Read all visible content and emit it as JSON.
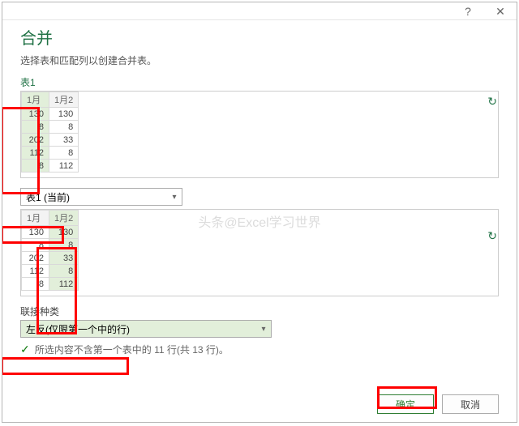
{
  "titlebar": {
    "help_icon": "?",
    "close_icon": "✕"
  },
  "header": {
    "title": "合并",
    "subtitle": "选择表和匹配列以创建合并表。"
  },
  "section1": {
    "label": "表1",
    "refresh_icon": "↻",
    "columns": [
      "1月",
      "1月2"
    ],
    "highlight_col_index": 0,
    "rows": [
      [
        130,
        130
      ],
      [
        8,
        8
      ],
      [
        202,
        33
      ],
      [
        112,
        8
      ],
      [
        8,
        112
      ]
    ]
  },
  "table_selector": {
    "value": "表1 (当前)",
    "refresh_icon": "↻"
  },
  "section2": {
    "columns": [
      "1月",
      "1月2"
    ],
    "highlight_col_index": 1,
    "rows": [
      [
        130,
        130
      ],
      [
        8,
        8
      ],
      [
        202,
        33
      ],
      [
        112,
        8
      ],
      [
        8,
        112
      ]
    ]
  },
  "join_type": {
    "label": "联接种类",
    "value": "左反(仅限第一个中的行)"
  },
  "status": {
    "text": "所选内容不含第一个表中的 11 行(共 13 行)。"
  },
  "buttons": {
    "ok": "确定",
    "cancel": "取消"
  },
  "watermark": "头条@Excel学习世界"
}
